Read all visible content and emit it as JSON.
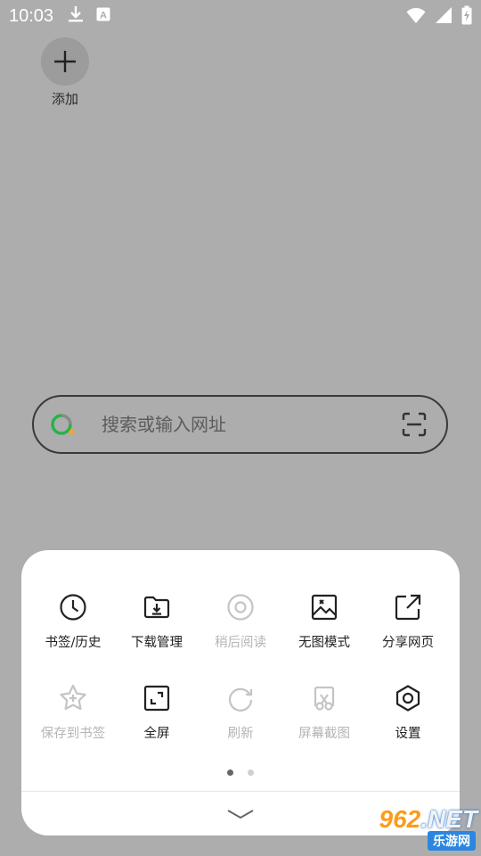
{
  "status_bar": {
    "time": "10:03",
    "left_icons": [
      "download-icon",
      "a-notification-icon"
    ],
    "right_icons": [
      "wifi-icon",
      "cellular-signal-icon",
      "battery-charging-icon"
    ]
  },
  "speed_dial": {
    "add_label": "添加"
  },
  "search": {
    "placeholder": "搜索或输入网址",
    "logo_colors": [
      "#26b24a",
      "#f5a623"
    ]
  },
  "menu": {
    "items": [
      {
        "label": "书签/历史",
        "icon": "clock-icon",
        "enabled": true
      },
      {
        "label": "下载管理",
        "icon": "download-folder-icon",
        "enabled": true
      },
      {
        "label": "稍后阅读",
        "icon": "read-later-icon",
        "enabled": false
      },
      {
        "label": "无图模式",
        "icon": "no-image-icon",
        "enabled": true
      },
      {
        "label": "分享网页",
        "icon": "share-icon",
        "enabled": true
      },
      {
        "label": "保存到书签",
        "icon": "star-add-icon",
        "enabled": false
      },
      {
        "label": "全屏",
        "icon": "fullscreen-icon",
        "enabled": true
      },
      {
        "label": "刷新",
        "icon": "refresh-icon",
        "enabled": false
      },
      {
        "label": "屏幕截图",
        "icon": "screenshot-icon",
        "enabled": false
      },
      {
        "label": "设置",
        "icon": "settings-hex-icon",
        "enabled": true
      }
    ],
    "page_count": 2,
    "current_page": 1
  },
  "watermark": {
    "top_text": "962.NET",
    "top_highlight": "962",
    "top_rest": ".NET",
    "bottom_text": "乐游网"
  }
}
